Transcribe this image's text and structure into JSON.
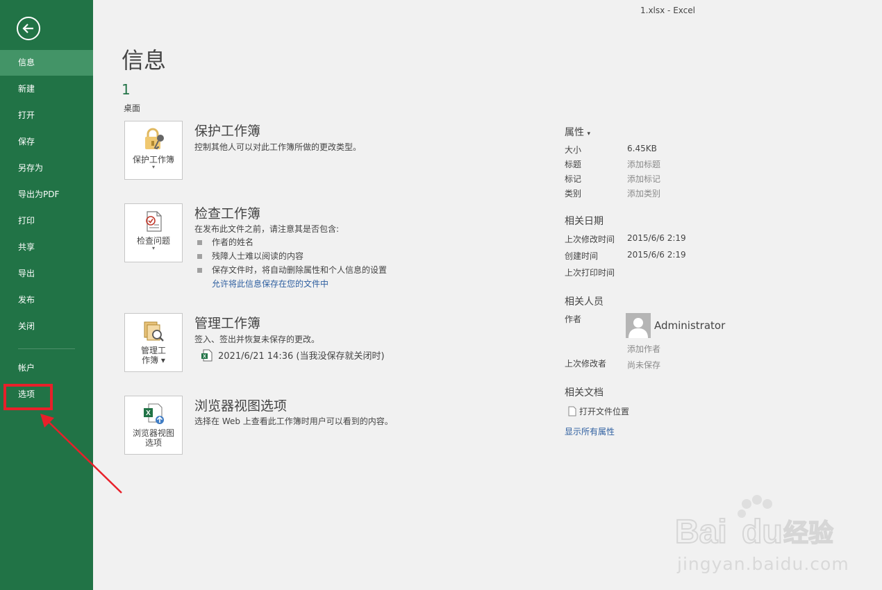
{
  "window": {
    "title": "1.xlsx  -  Excel"
  },
  "sidebar": {
    "back_icon": "back-arrow-icon",
    "items": [
      {
        "label": "信息",
        "active": true
      },
      {
        "label": "新建"
      },
      {
        "label": "打开"
      },
      {
        "label": "保存"
      },
      {
        "label": "另存为"
      },
      {
        "label": "导出为PDF"
      },
      {
        "label": "打印"
      },
      {
        "label": "共享"
      },
      {
        "label": "导出"
      },
      {
        "label": "发布"
      },
      {
        "label": "关闭"
      },
      {
        "label": "帐户"
      },
      {
        "label": "选项"
      }
    ]
  },
  "main": {
    "title": "信息",
    "file_name": "1",
    "file_location": "桌面",
    "protect": {
      "button_label": "保护工作簿",
      "title": "保护工作簿",
      "desc": "控制其他人可以对此工作簿所做的更改类型。"
    },
    "inspect": {
      "button_label": "检查问题",
      "title": "检查工作簿",
      "desc": "在发布此文件之前，请注意其是否包含:",
      "bullets": [
        "作者的姓名",
        "残障人士难以阅读的内容",
        "保存文件时，将自动删除属性和个人信息的设置"
      ],
      "link": "允许将此信息保存在您的文件中"
    },
    "manage": {
      "button_label_1": "管理工",
      "button_label_2": "作簿",
      "title": "管理工作簿",
      "desc": "签入、签出并恢复未保存的更改。",
      "version": "2021/6/21 14:36 (当我没保存就关闭时)"
    },
    "browser": {
      "button_label_1": "浏览器视图",
      "button_label_2": "选项",
      "title": "浏览器视图选项",
      "desc": "选择在 Web 上查看此工作簿时用户可以看到的内容。"
    }
  },
  "properties": {
    "heading": "属性",
    "size_label": "大小",
    "size_value": "6.45KB",
    "title_label": "标题",
    "title_add": "添加标题",
    "tags_label": "标记",
    "tags_add": "添加标记",
    "category_label": "类别",
    "category_add": "添加类别",
    "dates_heading": "相关日期",
    "modified_label": "上次修改时间",
    "modified_value": "2015/6/6 2:19",
    "created_label": "创建时间",
    "created_value": "2015/6/6 2:19",
    "printed_label": "上次打印时间",
    "people_heading": "相关人员",
    "author_label": "作者",
    "author_name": "Administrator",
    "add_author": "添加作者",
    "last_modified_by_label": "上次修改者",
    "last_modified_by_value": "尚未保存",
    "docs_heading": "相关文档",
    "open_location": "打开文件位置",
    "show_all": "显示所有属性"
  },
  "watermark": {
    "brand": "Bai du 经验",
    "url": "jingyan.baidu.com"
  },
  "colors": {
    "sidebar": "#217346",
    "active": "#439467",
    "highlight": "#e8202a",
    "link": "#2e5fa0"
  }
}
